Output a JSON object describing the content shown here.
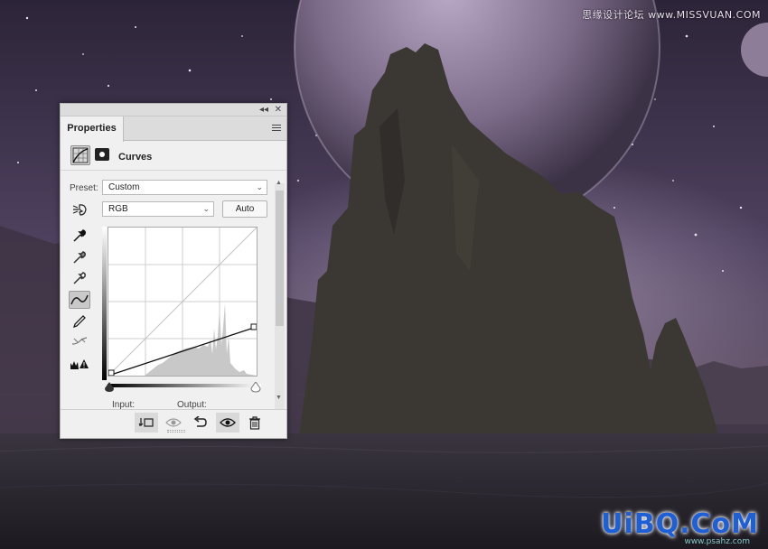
{
  "watermark": {
    "top_text": "思缘设计论坛 www.MISSVUAN.COM",
    "logo_text": "UiBQ.CoM",
    "sub_text": "www.psahz.com"
  },
  "panel": {
    "collapse_glyph": "◂◂",
    "close_glyph": "✕",
    "tab_label": "Properties",
    "adjustment_title": "Curves",
    "preset_label": "Preset:",
    "preset_value": "Custom",
    "channel_value": "RGB",
    "auto_label": "Auto",
    "input_label": "Input:",
    "output_label": "Output:"
  },
  "curve": {
    "points": [
      [
        0,
        0
      ],
      [
        255,
        84
      ]
    ],
    "input_range": [
      0,
      255
    ]
  },
  "colors": {
    "panel_bg": "#f0f0f0",
    "sky_top": "#2c2438",
    "sky_mid": "#5a4a66",
    "rock": "#3b3833",
    "ground": "#26232a",
    "logo": "#1f5fd6"
  }
}
